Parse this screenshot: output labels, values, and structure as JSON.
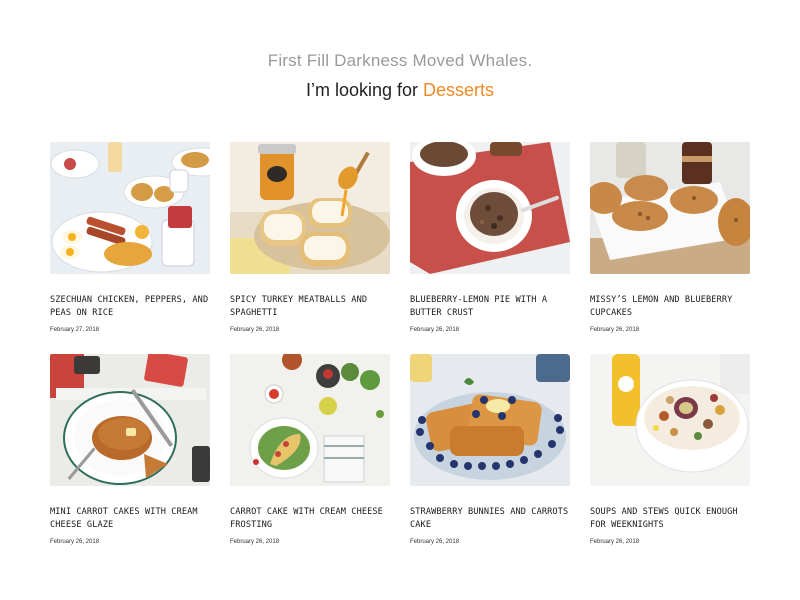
{
  "header": {
    "tagline": "First Fill Darkness Moved Whales.",
    "looking_prefix": "I’m looking for",
    "looking_category": "Desserts",
    "accent_color": "#f08a24"
  },
  "posts": [
    {
      "title": "Szechuan Chicken, Peppers, and Peas on Rice",
      "date": "February 27, 2018",
      "image": "breakfast-plates"
    },
    {
      "title": "Spicy Turkey Meatballs and Spaghetti",
      "date": "February 26, 2018",
      "image": "bread-with-honey"
    },
    {
      "title": "Blueberry-Lemon Pie with a Butter Crust",
      "date": "February 26, 2018",
      "image": "granola-bowl"
    },
    {
      "title": "Missy’s Lemon and Blueberry Cupcakes",
      "date": "February 26, 2018",
      "image": "oat-cookies"
    },
    {
      "title": "Mini Carrot Cakes with Cream Cheese Glaze",
      "date": "February 26, 2018",
      "image": "pancakes-plate"
    },
    {
      "title": "Carrot Cake with Cream Cheese Frosting",
      "date": "February 26, 2018",
      "image": "omelette-plate"
    },
    {
      "title": "Strawberry Bunnies and Carrots Cake",
      "date": "February 26, 2018",
      "image": "french-toast"
    },
    {
      "title": "Soups and Stews Quick Enough for Weeknights",
      "date": "February 26, 2018",
      "image": "fruit-yogurt-bowl"
    }
  ]
}
